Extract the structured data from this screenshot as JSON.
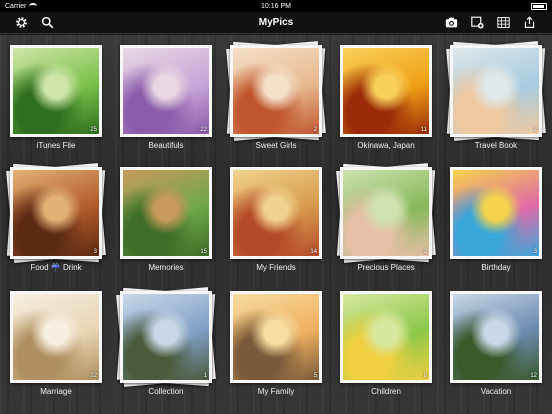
{
  "status": {
    "carrier": "Carrier",
    "time": "10:16 PM"
  },
  "nav": {
    "title": "MyPics"
  },
  "albums": [
    {
      "name": "iTunes File",
      "count": "25",
      "stacked": false,
      "palette": [
        "#7ac04a",
        "#2f6e1f",
        "#cfe6a8"
      ]
    },
    {
      "name": "Beautifuls",
      "count": "22",
      "stacked": false,
      "palette": [
        "#c9a4d9",
        "#8a5cab",
        "#e9d8e3"
      ]
    },
    {
      "name": "Sweet Girls",
      "count": "2",
      "stacked": true,
      "palette": [
        "#e8b98f",
        "#c0562e",
        "#f5e0c8"
      ]
    },
    {
      "name": "Okinawa, Japan",
      "count": "11",
      "stacked": false,
      "palette": [
        "#f0a014",
        "#9a2a08",
        "#f9d15a"
      ]
    },
    {
      "name": "Travel Book",
      "count": "2",
      "stacked": true,
      "palette": [
        "#a6cbe0",
        "#f0c9a0",
        "#dfe8ea"
      ]
    },
    {
      "name": "Food ☔ Drink",
      "count": "3",
      "stacked": true,
      "palette": [
        "#b15a2a",
        "#5c2a13",
        "#e3b276"
      ]
    },
    {
      "name": "Memories",
      "count": "15",
      "stacked": false,
      "palette": [
        "#6fa84a",
        "#3d6d26",
        "#c89a5c"
      ]
    },
    {
      "name": "My Friends",
      "count": "14",
      "stacked": false,
      "palette": [
        "#d69a4c",
        "#b54a2a",
        "#f2d38d"
      ]
    },
    {
      "name": "Precious Places",
      "count": "2",
      "stacked": true,
      "palette": [
        "#86b85a",
        "#e8c0a8",
        "#cfe3b0"
      ]
    },
    {
      "name": "Birthday",
      "count": "3",
      "stacked": false,
      "palette": [
        "#e06aa8",
        "#3aa7d9",
        "#f5d34a"
      ]
    },
    {
      "name": "Marriage",
      "count": "22",
      "stacked": false,
      "palette": [
        "#e8d5b3",
        "#b09060",
        "#f7efe0"
      ]
    },
    {
      "name": "Collection",
      "count": "1",
      "stacked": true,
      "palette": [
        "#7fa0c8",
        "#4a5a3a",
        "#c8d8e8"
      ]
    },
    {
      "name": "My Family",
      "count": "5",
      "stacked": false,
      "palette": [
        "#f0b060",
        "#7a5a3a",
        "#f8dca0"
      ]
    },
    {
      "name": "Children",
      "count": "8",
      "stacked": false,
      "palette": [
        "#8cc84a",
        "#f0d040",
        "#d8e8a0"
      ]
    },
    {
      "name": "Vacation",
      "count": "12",
      "stacked": false,
      "palette": [
        "#6a8ab0",
        "#3a5a2a",
        "#c8d8e8"
      ]
    }
  ]
}
